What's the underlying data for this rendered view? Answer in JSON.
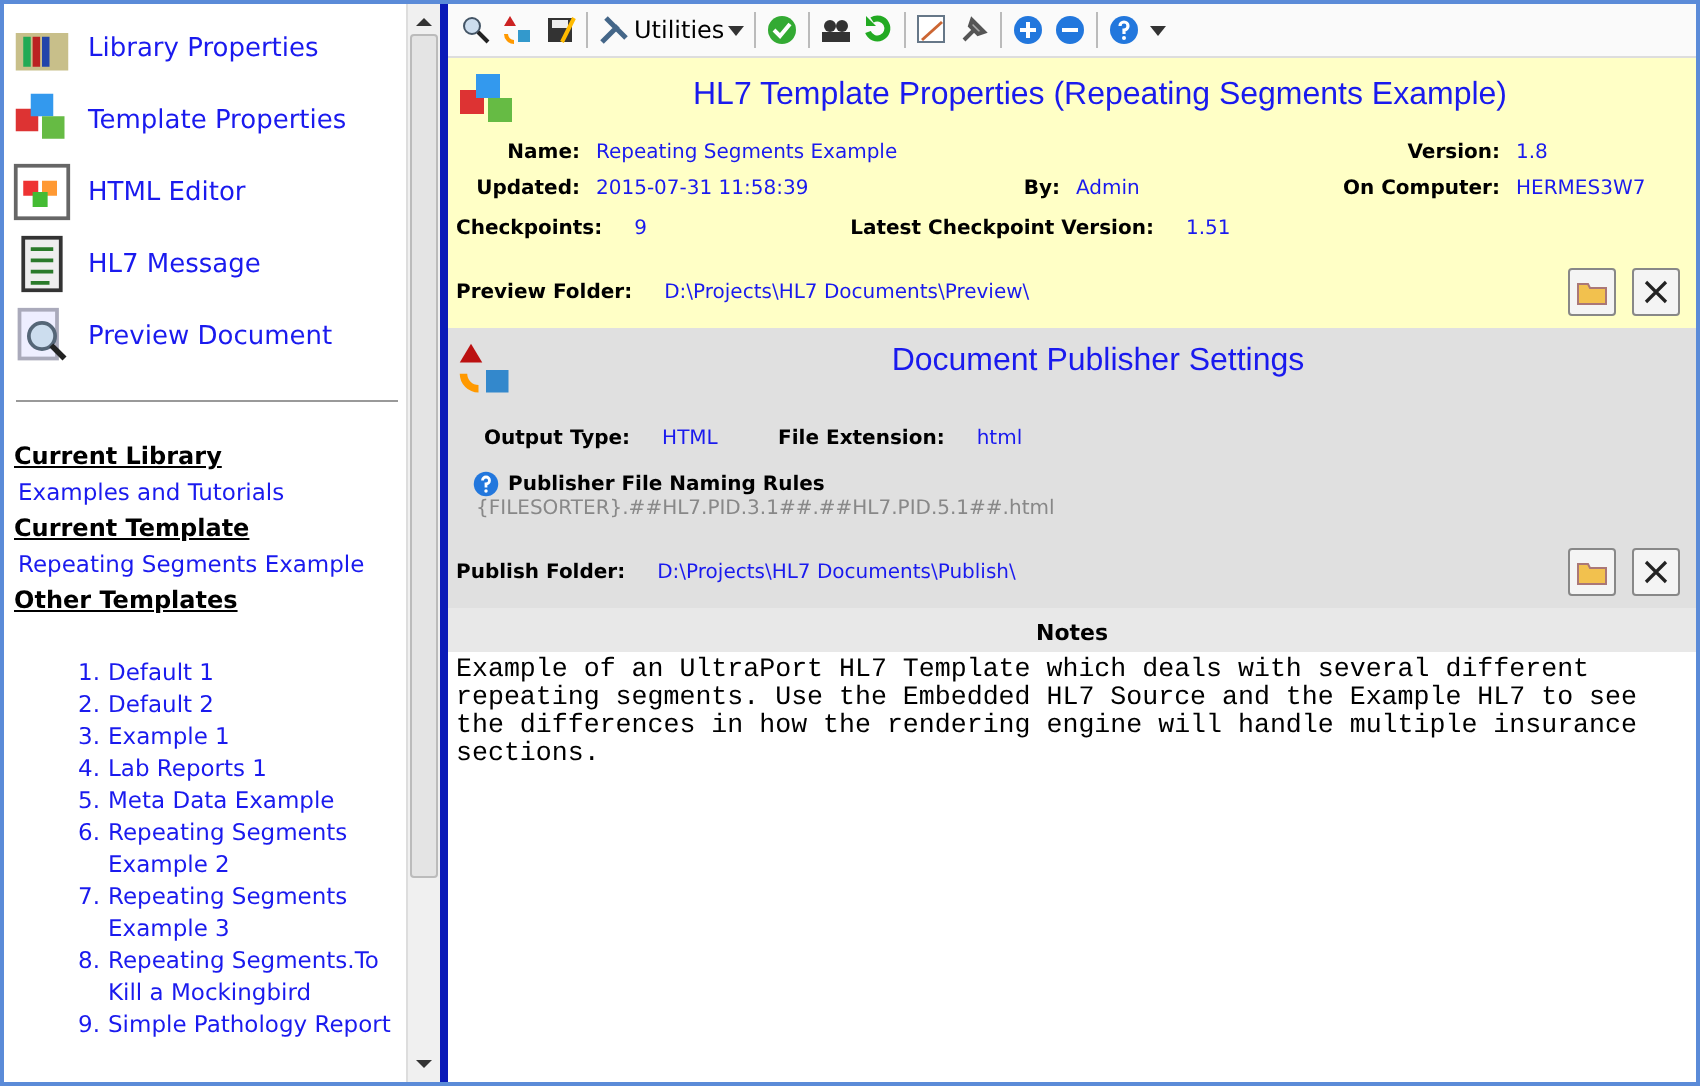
{
  "sidebar": {
    "nav": [
      {
        "kind": "library",
        "label": "Library Properties"
      },
      {
        "kind": "template",
        "label": "Template Properties"
      },
      {
        "kind": "html",
        "label": "HTML Editor"
      },
      {
        "kind": "message",
        "label": "HL7 Message"
      },
      {
        "kind": "preview",
        "label": "Preview Document"
      }
    ],
    "current_library": {
      "heading": "Current Library",
      "value": "Examples and Tutorials"
    },
    "current_template": {
      "heading": "Current Template",
      "value": "Repeating Segments Example"
    },
    "other_templates": {
      "heading": "Other Templates",
      "items": [
        {
          "number": "1.",
          "label": "Default 1"
        },
        {
          "number": "2.",
          "label": "Default 2"
        },
        {
          "number": "3.",
          "label": "Example 1"
        },
        {
          "number": "4.",
          "label": "Lab Reports 1"
        },
        {
          "number": "5.",
          "label": "Meta Data Example"
        },
        {
          "number": "6.",
          "label": "Repeating Segments Example 2"
        },
        {
          "number": "7.",
          "label": "Repeating Segments Example 3"
        },
        {
          "number": "8.",
          "label": "Repeating Segments.To Kill a Mockingbird"
        },
        {
          "number": "9.",
          "label": "Simple Pathology Report"
        }
      ]
    }
  },
  "toolbar": {
    "utilities": "Utilities"
  },
  "template_properties": {
    "title": "HL7 Template Properties (Repeating Segments Example)",
    "name": {
      "label": "Name:",
      "value": "Repeating Segments Example"
    },
    "version": {
      "label": "Version:",
      "value": "1.8"
    },
    "updated": {
      "label": "Updated:",
      "value": "2015-07-31 11:58:39"
    },
    "by": {
      "label": "By:",
      "value": "Admin"
    },
    "computer": {
      "label": "On Computer:",
      "value": "HERMES3W7"
    },
    "checkpoints": {
      "label": "Checkpoints:",
      "value": "9"
    },
    "latest": {
      "label": "Latest Checkpoint Version:",
      "value": "1.51"
    },
    "folder": {
      "label": "Preview Folder:",
      "value": "D:\\Projects\\HL7 Documents\\Preview\\"
    }
  },
  "publisher": {
    "title": "Document Publisher Settings",
    "output": {
      "label": "Output Type:",
      "value": "HTML"
    },
    "extension": {
      "label": "File Extension:",
      "value": "html"
    },
    "rules_label": "Publisher File Naming Rules",
    "rules_value": "{FILESORTER}.##HL7.PID.3.1##.##HL7.PID.5.1##.html",
    "folder": {
      "label": "Publish Folder:",
      "value": "D:\\Projects\\HL7 Documents\\Publish\\"
    }
  },
  "notes": {
    "heading": "Notes",
    "text": "Example of an UltraPort HL7 Template which deals with several different repeating segments. Use the Embedded HL7 Source and the Example HL7 to see the differences in how the rendering engine will handle multiple insurance sections."
  }
}
